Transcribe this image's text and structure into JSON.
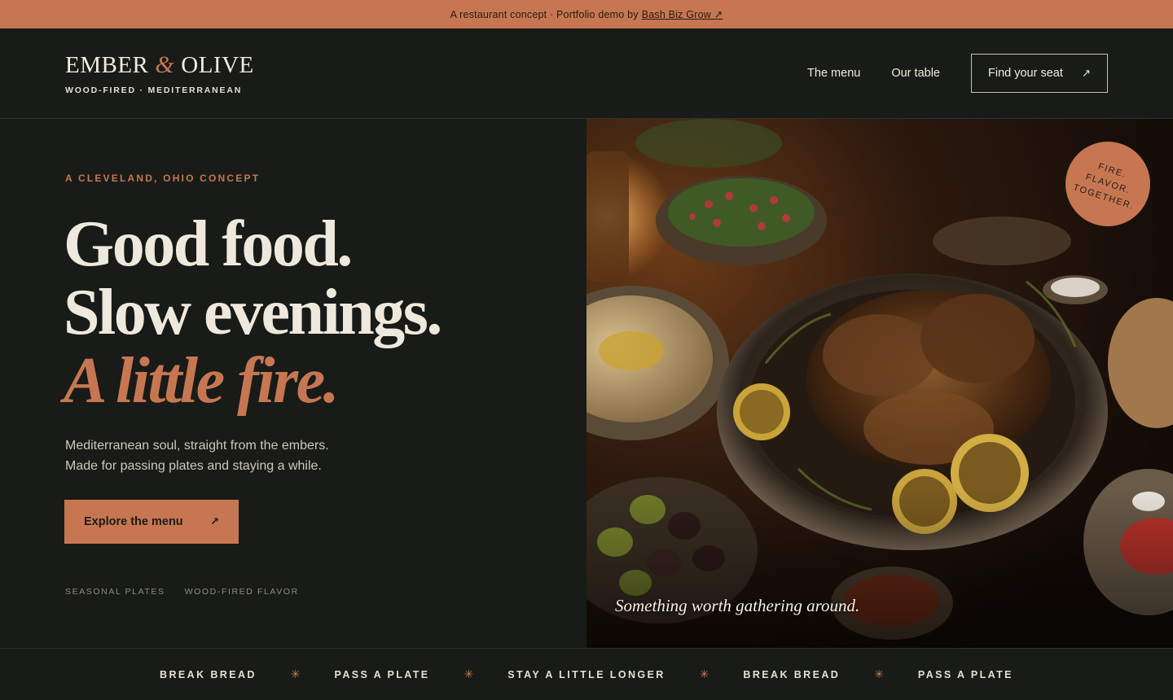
{
  "banner": {
    "text": "A restaurant concept · Portfolio demo by",
    "link_label": "Bash Biz Grow ↗"
  },
  "header": {
    "logo": {
      "name_left": "EMBER",
      "ampersand": "&",
      "name_right": "OLIVE",
      "tagline": "WOOD-FIRED · MEDITERRANEAN"
    },
    "nav": {
      "links": [
        "The menu",
        "Our table"
      ],
      "cta_label": "Find your seat",
      "cta_icon": "↗"
    }
  },
  "hero": {
    "eyebrow": "A CLEVELAND, OHIO CONCEPT",
    "headline": {
      "line1": "Good food.",
      "line2": "Slow evenings.",
      "line3": "A little fire."
    },
    "lede": {
      "line1": "Mediterranean soul, straight from the embers.",
      "line2": "Made for passing plates and staying a while."
    },
    "button_label": "Explore the menu",
    "button_icon": "↗",
    "tags": [
      "SEASONAL PLATES",
      "WOOD-FIRED FLAVOR"
    ]
  },
  "image": {
    "caption": "Something worth gathering around.",
    "badge": [
      "FIRE.",
      "FLAVOR.",
      "TOGETHER."
    ]
  },
  "marquee": {
    "items": [
      "BREAK BREAD",
      "PASS A PLATE",
      "STAY A LITTLE LONGER",
      "BREAK BREAD",
      "PASS A PLATE"
    ],
    "separator": "✳"
  },
  "colors": {
    "accent": "#c67752",
    "background": "#181b18",
    "cream": "#efe8dc"
  }
}
